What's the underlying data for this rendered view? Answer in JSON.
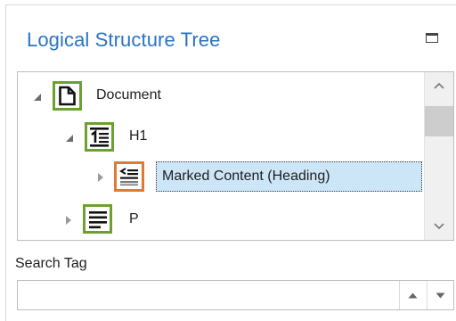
{
  "panel": {
    "title": "Logical Structure Tree",
    "restore_icon": "window-restore-icon"
  },
  "tree": {
    "nodes": [
      {
        "label": "Document",
        "icon": "document-icon",
        "expanded": true,
        "level": 0
      },
      {
        "label": "H1",
        "icon": "heading-icon",
        "expanded": true,
        "level": 1
      },
      {
        "label": "Marked Content (Heading)",
        "icon": "marked-content-icon",
        "expanded": false,
        "level": 2,
        "selected": true
      },
      {
        "label": "P",
        "icon": "paragraph-icon",
        "expanded": false,
        "level": 1
      }
    ],
    "highlight_colors": {
      "tag": "#6da033",
      "content": "#e07a2f",
      "selection": "#cde6f7"
    }
  },
  "scrollbar": {
    "up_icon": "chevron-up-icon",
    "down_icon": "chevron-down-icon"
  },
  "search": {
    "label": "Search Tag",
    "value": "",
    "placeholder": "",
    "up_icon": "triangle-up-icon",
    "down_icon": "triangle-down-icon"
  },
  "colors": {
    "title": "#2a73c2"
  }
}
